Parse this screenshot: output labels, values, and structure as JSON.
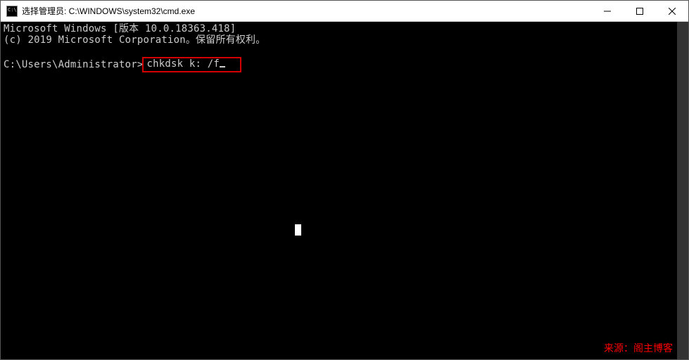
{
  "titlebar": {
    "title": "选择管理员: C:\\WINDOWS\\system32\\cmd.exe"
  },
  "terminal": {
    "line1": "Microsoft Windows [版本 10.0.18363.418]",
    "line2": "(c) 2019 Microsoft Corporation。保留所有权利。",
    "prompt": "C:\\Users\\Administrator>",
    "command": "chkdsk k: /f"
  },
  "watermark": "来源：阁主博客"
}
